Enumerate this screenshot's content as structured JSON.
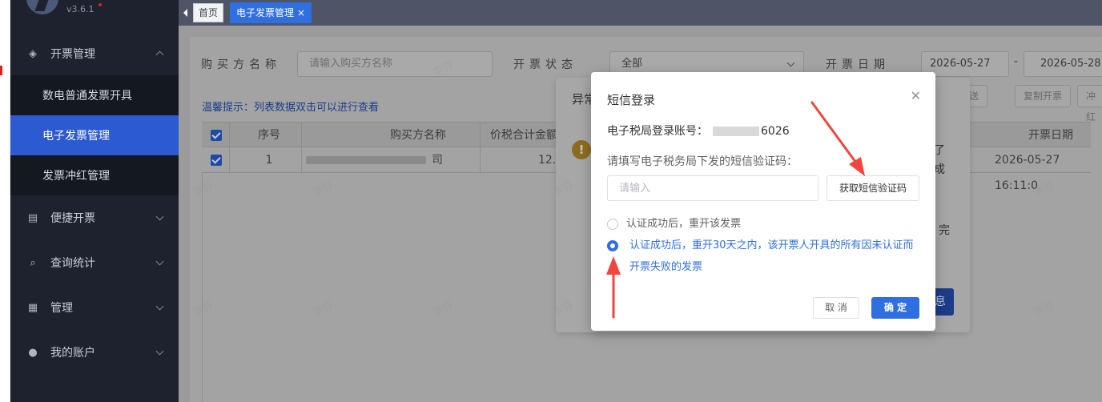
{
  "app": {
    "version": "v3.6.1"
  },
  "sidebar": {
    "items": [
      {
        "label": "开票管理",
        "icon": "diamond-icon",
        "expanded": true
      },
      {
        "label": "便捷开票",
        "icon": "document-icon",
        "expanded": false
      },
      {
        "label": "查询统计",
        "icon": "search-icon",
        "expanded": false
      },
      {
        "label": "管理",
        "icon": "grid-icon",
        "expanded": false
      },
      {
        "label": "我的账户",
        "icon": "user-icon",
        "expanded": false
      }
    ],
    "subitems": [
      {
        "label": "数电普通发票开具",
        "active": false
      },
      {
        "label": "电子发票管理",
        "active": true
      },
      {
        "label": "发票冲红管理",
        "active": false
      }
    ]
  },
  "tabs": {
    "home": "首页",
    "active": "电子发票管理"
  },
  "filters": {
    "buyer_label": "购买方名称",
    "buyer_placeholder": "请输入购买方名称",
    "status_label": "开票状态",
    "status_value": "全部",
    "date_label": "开票日期",
    "date_from": "2026-05-27",
    "date_sep": "-",
    "date_to": "2026-05-28"
  },
  "tip": "温馨提示：列表数据双击可以进行查看",
  "toolbar": {
    "resend": "次发送",
    "copy": "复制开票",
    "redflush": "冲红"
  },
  "table": {
    "headers": {
      "index": "序号",
      "buyer": "购买方名称",
      "amount": "价税合计金额",
      "date": "开票日期"
    },
    "rows": [
      {
        "index": "1",
        "buyer_suffix": "司",
        "amount": "12.50",
        "date": "2026-05-27 16:11:0"
      }
    ]
  },
  "bg_dialog": {
    "title": "异常",
    "frag1": "了",
    "frag2": "成",
    "frag3": "完",
    "button_frag": "息"
  },
  "watermark": "李芬",
  "modal": {
    "title": "短信登录",
    "account_label": "电子税局登录账号：",
    "account_tail": "6026",
    "hint": "请填写电子税务局下发的短信验证码：",
    "code_placeholder": "请输入",
    "get_code": "获取短信验证码",
    "option1": "认证成功后，重开该发票",
    "option2": "认证成功后，重开30天之内，该开票人开具的所有因未认证而开票失败的发票",
    "cancel": "取 消",
    "ok": "确 定"
  },
  "colors": {
    "primary": "#2f6fe0",
    "sidebar": "#1d222e",
    "annotation": "#f2453d"
  }
}
